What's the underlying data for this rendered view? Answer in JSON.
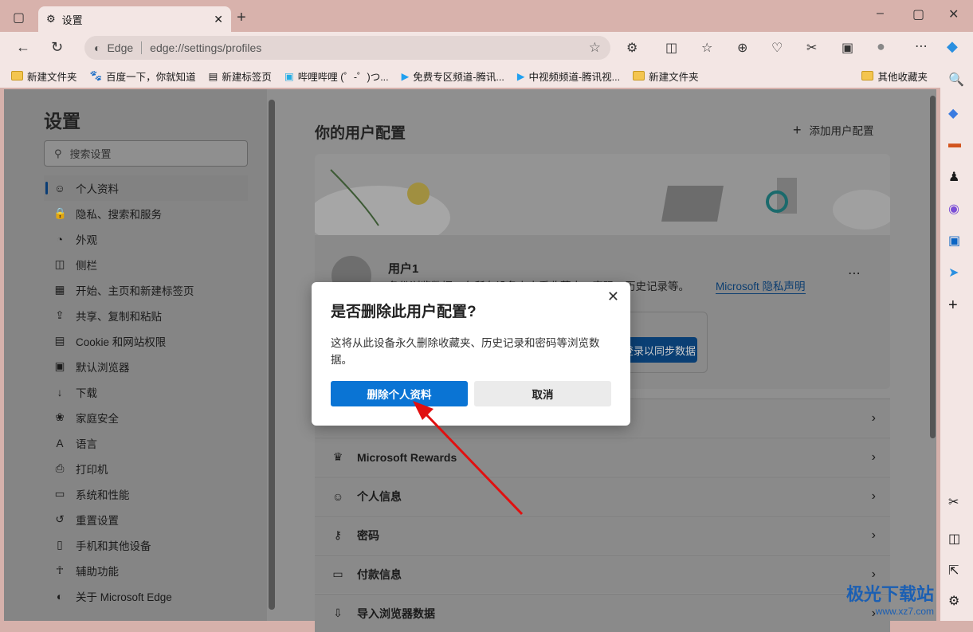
{
  "browser": {
    "tab_title": "设置",
    "address_brand": "Edge",
    "url": "edge://settings/profiles"
  },
  "bookmarks": [
    {
      "icon": "folder-icon",
      "label": "新建文件夹"
    },
    {
      "icon": "baidu-icon",
      "label": "百度一下，你就知道"
    },
    {
      "icon": "page-icon",
      "label": "新建标签页"
    },
    {
      "icon": "bilibili-icon",
      "label": "哔哩哔哩 (゜-゜)つ..."
    },
    {
      "icon": "tencent-video-icon",
      "label": "免费专区频道-腾讯..."
    },
    {
      "icon": "tencent-video-icon",
      "label": "中视频频道-腾讯视..."
    },
    {
      "icon": "folder-icon",
      "label": "新建文件夹"
    }
  ],
  "other_bookmarks": "其他收藏夹",
  "settings": {
    "title": "设置",
    "search_placeholder": "搜索设置",
    "nav": [
      {
        "icon": "profile-icon",
        "label": "个人资料"
      },
      {
        "icon": "lock-icon",
        "label": "隐私、搜索和服务"
      },
      {
        "icon": "palette-icon",
        "label": "外观"
      },
      {
        "icon": "sidebar-icon",
        "label": "侧栏"
      },
      {
        "icon": "home-icon",
        "label": "开始、主页和新建标签页"
      },
      {
        "icon": "share-icon",
        "label": "共享、复制和粘贴"
      },
      {
        "icon": "cookie-icon",
        "label": "Cookie 和网站权限"
      },
      {
        "icon": "browser-icon",
        "label": "默认浏览器"
      },
      {
        "icon": "download-icon",
        "label": "下载"
      },
      {
        "icon": "family-icon",
        "label": "家庭安全"
      },
      {
        "icon": "language-icon",
        "label": "语言"
      },
      {
        "icon": "printer-icon",
        "label": "打印机"
      },
      {
        "icon": "laptop-icon",
        "label": "系统和性能"
      },
      {
        "icon": "reset-icon",
        "label": "重置设置"
      },
      {
        "icon": "phone-icon",
        "label": "手机和其他设备"
      },
      {
        "icon": "accessibility-icon",
        "label": "辅助功能"
      },
      {
        "icon": "edge-icon",
        "label": "关于 Microsoft Edge"
      }
    ]
  },
  "main": {
    "title": "你的用户配置",
    "add_profile": "添加用户配置",
    "profile_name": "用户1",
    "profile_desc": "备份浏览数据，在所有设备上查看收藏夹、密码、历史记录等。",
    "privacy_link": "Microsoft 隐私声明",
    "sync_button": "登录以同步数据",
    "rows": [
      {
        "icon": "trophy-icon",
        "label": "Microsoft Rewards"
      },
      {
        "icon": "person-info-icon",
        "label": "个人信息"
      },
      {
        "icon": "key-icon",
        "label": "密码"
      },
      {
        "icon": "card-icon",
        "label": "付款信息"
      },
      {
        "icon": "import-icon",
        "label": "导入浏览器数据"
      }
    ]
  },
  "dialog": {
    "title": "是否删除此用户配置?",
    "body": "这将从此设备永久删除收藏夹、历史记录和密码等浏览数据。",
    "delete_button": "删除个人资料",
    "cancel_button": "取消"
  },
  "watermark": {
    "name": "极光下载站",
    "url": "www.xz7.com"
  },
  "colors": {
    "accent": "#0a74d4",
    "arrow": "#e01010",
    "titlebar": "#d8b2ac"
  }
}
